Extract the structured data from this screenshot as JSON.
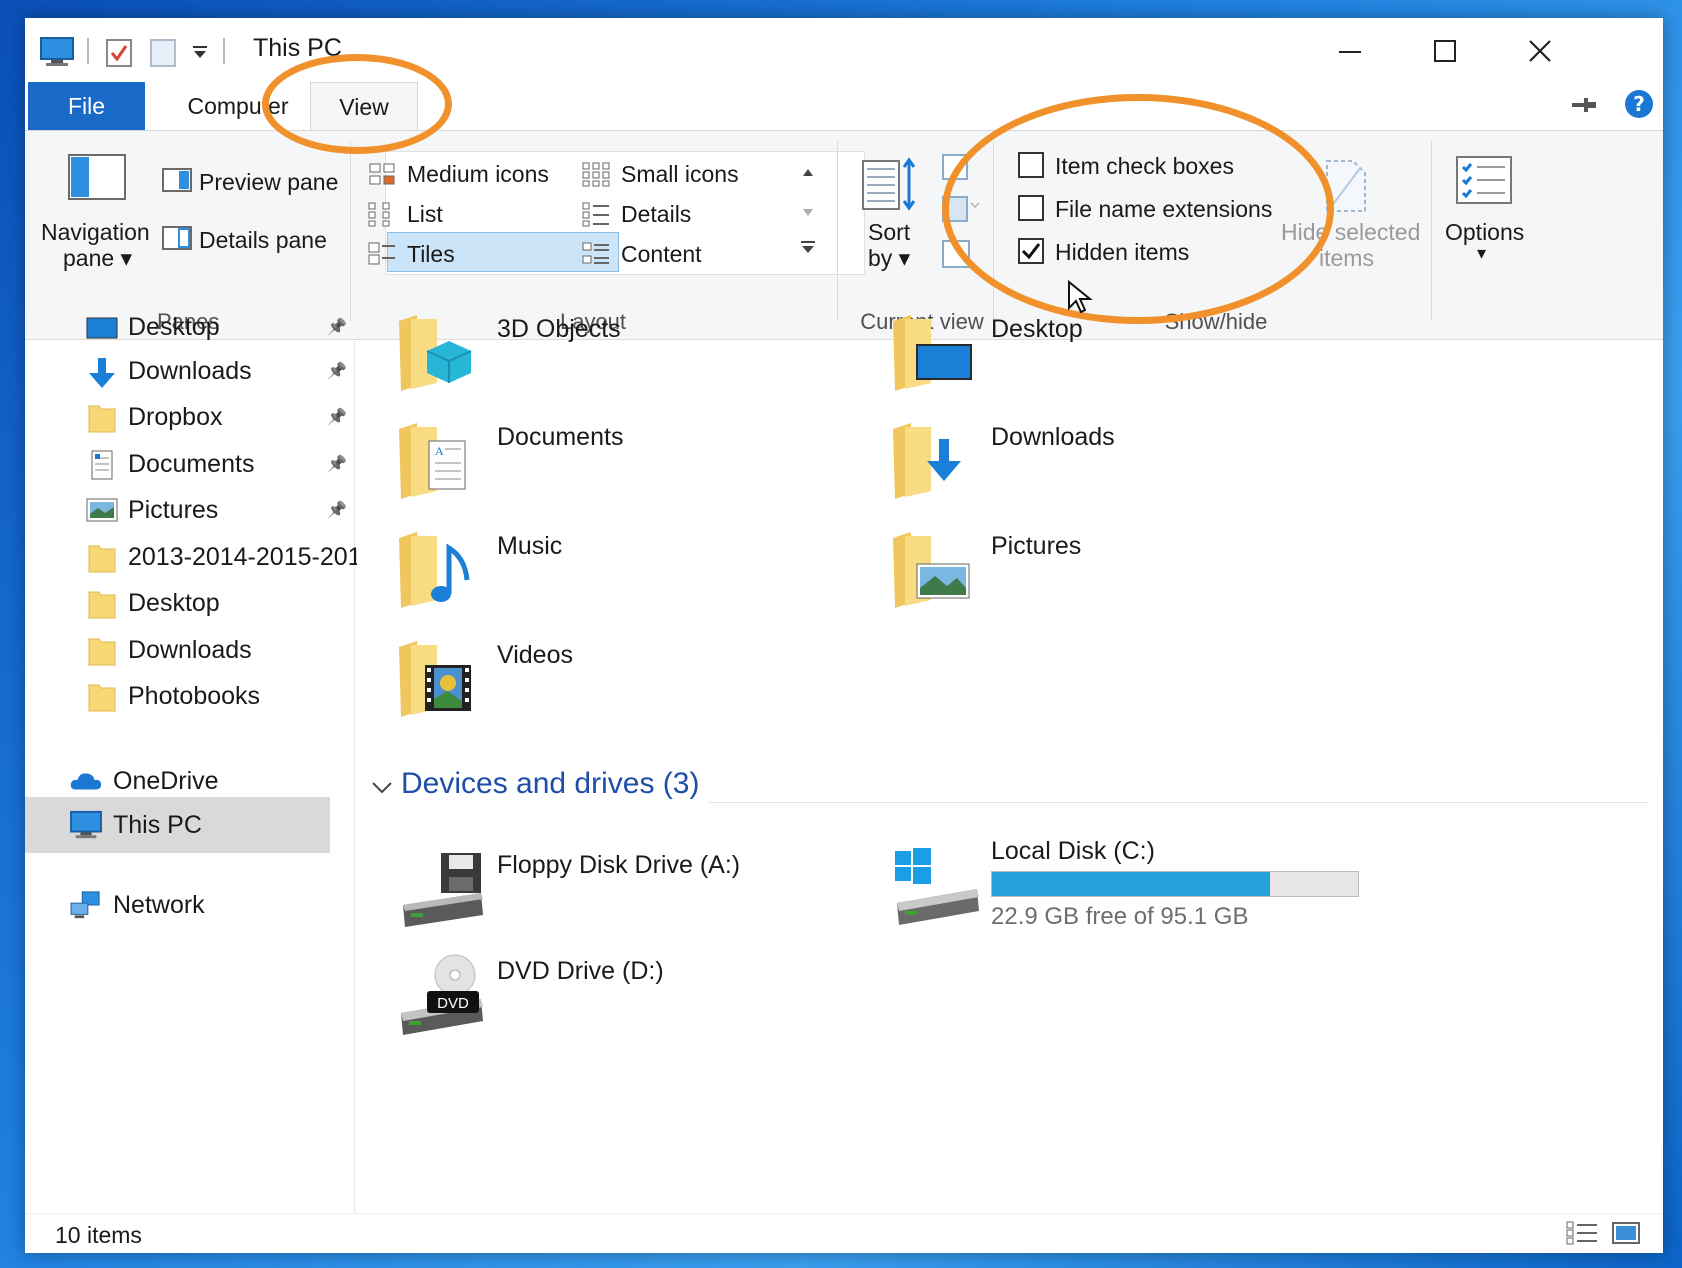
{
  "window": {
    "title": "This PC",
    "status_text": "10 items"
  },
  "tabs": [
    {
      "label": "File"
    },
    {
      "label": "Computer"
    },
    {
      "label": "View"
    }
  ],
  "ribbon": {
    "panes": {
      "nav_pane_label_1": "Navigation",
      "nav_pane_label_2": "pane",
      "preview_pane": "Preview pane",
      "details_pane": "Details pane",
      "group_label": "Panes"
    },
    "layout": {
      "medium_icons": "Medium icons",
      "small_icons": "Small icons",
      "list": "List",
      "details": "Details",
      "tiles": "Tiles",
      "content": "Content",
      "group_label": "Layout"
    },
    "current_view": {
      "sort_1": "Sort",
      "sort_2": "by",
      "group_label": "Current view"
    },
    "show_hide": {
      "item_check_boxes": "Item check boxes",
      "item_check_boxes_checked": false,
      "file_name_extensions": "File name extensions",
      "file_name_extensions_checked": false,
      "hidden_items": "Hidden items",
      "hidden_items_checked": true,
      "hide_selected_1": "Hide selected",
      "hide_selected_2": "items",
      "group_label": "Show/hide"
    },
    "options": {
      "label": "Options"
    }
  },
  "nav": {
    "items": [
      {
        "label": "Desktop",
        "icon": "desktop-icon",
        "pinned": true
      },
      {
        "label": "Downloads",
        "icon": "download-icon",
        "pinned": true
      },
      {
        "label": "Dropbox",
        "icon": "folder-icon",
        "pinned": true
      },
      {
        "label": "Documents",
        "icon": "documents-icon",
        "pinned": true
      },
      {
        "label": "Pictures",
        "icon": "pictures-icon",
        "pinned": true
      },
      {
        "label": "2013-2014-2015-201",
        "icon": "folder-icon",
        "pinned": false
      },
      {
        "label": "Desktop",
        "icon": "folder-icon",
        "pinned": false
      },
      {
        "label": "Downloads",
        "icon": "folder-icon",
        "pinned": false
      },
      {
        "label": "Photobooks",
        "icon": "folder-icon",
        "pinned": false
      }
    ],
    "onedrive": "OneDrive",
    "this_pc": "This PC",
    "network": "Network"
  },
  "content": {
    "folders": [
      {
        "label": "3D Objects",
        "icon": "3d-objects-icon"
      },
      {
        "label": "Desktop",
        "icon": "desktop-icon"
      },
      {
        "label": "Documents",
        "icon": "documents-icon"
      },
      {
        "label": "Downloads",
        "icon": "download-icon"
      },
      {
        "label": "Music",
        "icon": "music-icon"
      },
      {
        "label": "Pictures",
        "icon": "pictures-icon"
      },
      {
        "label": "Videos",
        "icon": "videos-icon"
      }
    ],
    "devices_header": "Devices and drives (3)",
    "drives": [
      {
        "label": "Floppy Disk Drive (A:)",
        "icon": "floppy-drive-icon"
      },
      {
        "label": "Local Disk (C:)",
        "icon": "local-disk-icon",
        "free_text": "22.9 GB free of 95.1 GB",
        "used_fraction": 0.759
      },
      {
        "label": "DVD Drive (D:)",
        "icon": "dvd-drive-icon",
        "badge": "DVD"
      }
    ]
  },
  "colors": {
    "accent": "#1969c6",
    "annotation": "#f0912c",
    "progress": "#26a0da",
    "section_header": "#1e4ea8"
  }
}
